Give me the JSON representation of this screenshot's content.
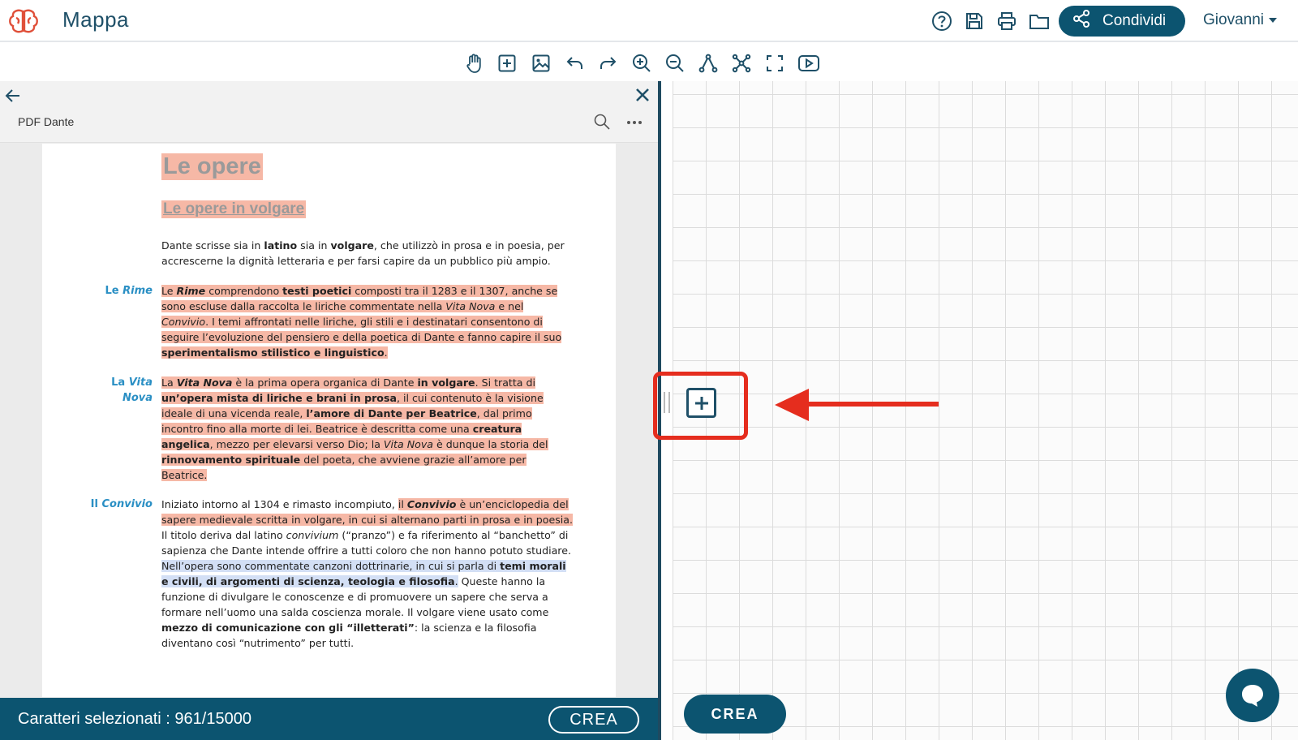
{
  "header": {
    "app_title": "Mappa",
    "icons": [
      "brain-logo-icon",
      "help-icon",
      "save-icon",
      "print-icon",
      "folder-icon"
    ],
    "share_label": "Condividi",
    "user_name": "Giovanni"
  },
  "toolbar": {
    "tools": [
      "hand-icon",
      "add-node-icon",
      "image-icon",
      "undo-icon",
      "redo-icon",
      "zoom-in-icon",
      "zoom-out-icon",
      "connector-icon",
      "expand-nodes-icon",
      "fullscreen-icon",
      "play-icon"
    ]
  },
  "pdf": {
    "file_name": "PDF Dante",
    "title": "Le opere",
    "subtitle": "Le opere in volgare",
    "intro": {
      "p1": "Dante scrisse sia in ",
      "b1": "latino",
      "p2": " sia in ",
      "b2": "volgare",
      "p3": ", che utilizzò in prosa e in poesia, per accrescerne la dignità letteraria e per farsi capire da un pubblico più ampio."
    },
    "rime": {
      "label_plain": "Le ",
      "label_em": "Rime",
      "t1": "Le ",
      "t2": "Rime",
      "t3": " comprendono ",
      "t4": "testi poetici",
      "t5": " composti tra il 1283 e il 1307, anche se sono escluse dalla raccolta le liriche commentate nella ",
      "t6": "Vita Nova",
      "t7": " e nel ",
      "t8": "Convivio",
      "t9": ". I temi affrontati nelle liriche, gli stili e i destinatari consentono di seguire l’evoluzione del pensiero e della poetica di Dante e fanno capire il suo ",
      "t10": "sperimentalismo stilistico e linguistico",
      "t11": "."
    },
    "vita_nova": {
      "label_plain": "La ",
      "label_em": "Vita Nova",
      "t1": "La ",
      "t2": "Vita Nova",
      "t3": " è la prima opera organica di Dante ",
      "t4": "in volgare",
      "t5": ". Si tratta di ",
      "t6": "un’opera mista di liriche e brani in prosa",
      "t7": ", il cui contenuto è la visione ideale di una vicenda reale, ",
      "t8": "l’amore di Dante per Beatrice",
      "t9": ", dal primo incontro fino alla morte di lei. Beatrice è descritta come una ",
      "t10": "creatura angelica",
      "t11": ", mezzo per elevarsi verso Dio; la ",
      "t12": "Vita Nova",
      "t13": " è dunque la storia del ",
      "t14": "rinnovamento spirituale",
      "t15": " del poeta, che avviene grazie all’amore per Beatrice."
    },
    "convivio": {
      "label_plain": "Il ",
      "label_em": "Convivio",
      "t1": "Iniziato intorno al 1304 e rimasto incompiuto, ",
      "t2": "il ",
      "t3": "Convivio",
      "t4": " è un’enciclopedia del sapere medievale scritta in volgare, in cui si alternano parti in prosa e in poesia.",
      "t5": " Il titolo deriva dal latino ",
      "t6": "convivium",
      "t7": " (“pranzo”) e fa riferimento al “banchetto” di sapienza che Dante intende offrire a tutti coloro che non hanno potuto studiare.",
      "t8": "Nell’opera sono commentate canzoni dottrinarie, in cui si parla di ",
      "t9": "temi morali e civili, di argomenti di scienza, teologia e filosofia",
      "t10": ".",
      "t11": " Queste hanno la funzione di divulgare le conoscenze e di promuovere un sapere che serva a formare nell’uomo una salda coscienza morale. Il volgare viene usato come ",
      "t12": "mezzo di comunicazione con gli “illetterati”",
      "t13": ": la scienza e la filosofia diventano così “nutrimento” per tutti."
    },
    "status_text": "Caratteri selezionati : 961/15000",
    "crea_label": "CREA"
  },
  "canvas": {
    "add_node_icon": "plus-square-icon",
    "crea_label": "CREA",
    "accent_color": "#0c5470",
    "highlight_color": "#e52d1e",
    "selection_color": "#f6b8a6"
  }
}
